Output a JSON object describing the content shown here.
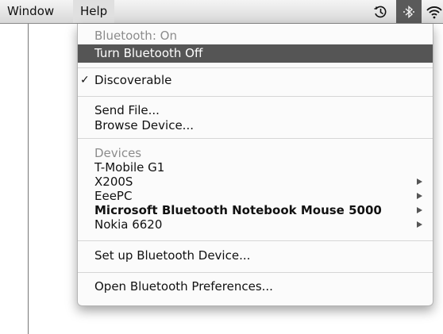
{
  "menubar": {
    "window_label": "Window",
    "help_label": "Help"
  },
  "status_icons": [
    "time-machine-icon",
    "bluetooth-icon",
    "wifi-icon"
  ],
  "menu": {
    "status_header": "Bluetooth: On",
    "turn_off": "Turn Bluetooth Off",
    "discoverable": "Discoverable",
    "discoverable_checked": "✓",
    "send_file": "Send File...",
    "browse_device": "Browse Device...",
    "devices_header": "Devices",
    "devices": [
      {
        "name": "T-Mobile G1"
      },
      {
        "name": "X200S"
      },
      {
        "name": "EeePC"
      },
      {
        "name": "Microsoft Bluetooth Notebook Mouse 5000"
      },
      {
        "name": "Nokia 6620"
      }
    ],
    "setup_device": "Set up Bluetooth Device...",
    "open_prefs": "Open Bluetooth Preferences..."
  },
  "colors": {
    "highlight": "#555555",
    "header_text": "#8c8c8c"
  }
}
